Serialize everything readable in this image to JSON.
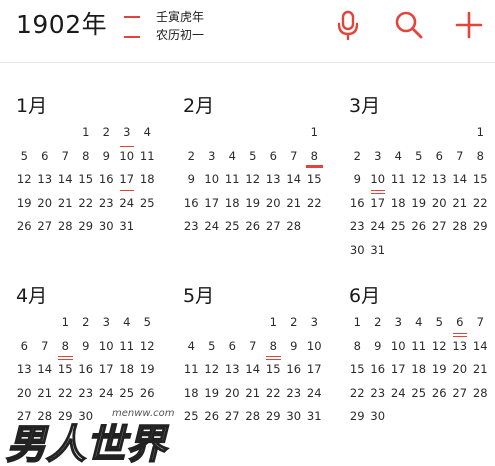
{
  "header": {
    "year_title": "1902年",
    "lunar_line1": "壬寅虎年",
    "lunar_line2": "农历初一",
    "accent_color": "#e0443a",
    "icons": [
      "microphone-icon",
      "search-icon",
      "plus-icon"
    ]
  },
  "months": [
    {
      "label": "1月",
      "offset": 3,
      "days": 31,
      "marks": {
        "10": "ol-thin",
        "17": "ul-thin"
      }
    },
    {
      "label": "2月",
      "offset": 6,
      "days": 28,
      "marks": {
        "8": "ul-thick"
      }
    },
    {
      "label": "3月",
      "offset": 6,
      "days": 31,
      "marks": {
        "10": "ul-thin",
        "17": "ol-thin"
      }
    },
    {
      "label": "4月",
      "offset": 2,
      "days": 30,
      "marks": {
        "8": "ul-thin",
        "15": "ol-thin"
      }
    },
    {
      "label": "5月",
      "offset": 4,
      "days": 31,
      "marks": {
        "8": "ul-thin",
        "15": "ol-thin"
      }
    },
    {
      "label": "6月",
      "offset": 0,
      "days": 30,
      "marks": {
        "6": "ul-thin",
        "13": "ol-thin"
      }
    }
  ],
  "watermark": {
    "url": "menww.com",
    "brand": "男人世界"
  }
}
